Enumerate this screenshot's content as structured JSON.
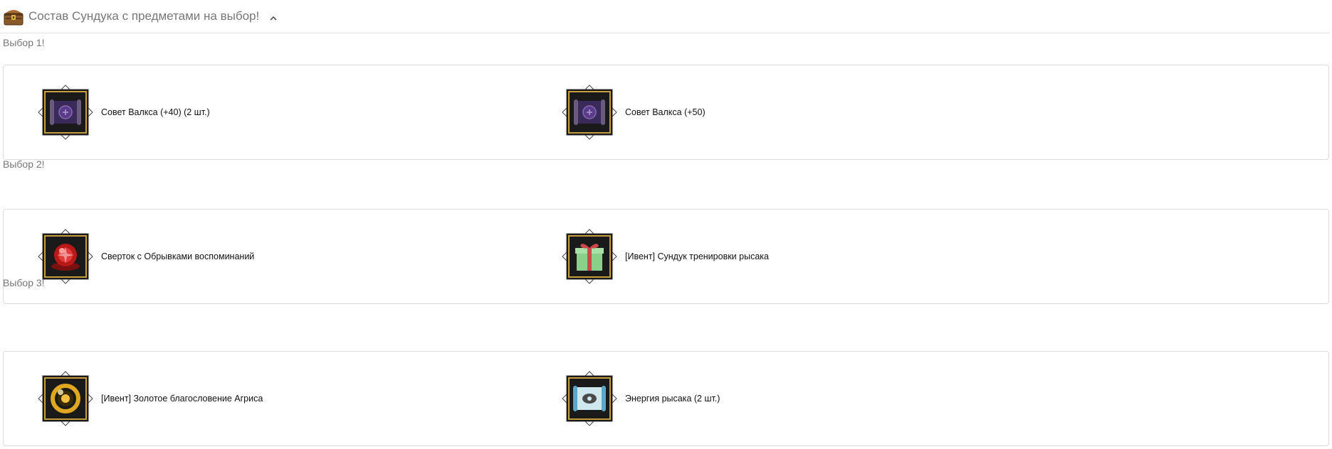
{
  "header": {
    "title": "Состав Сундука с предметами на выбор!",
    "chest_icon": "treasure-chest-icon",
    "collapse_icon": "chevron-up-icon"
  },
  "groups": [
    {
      "label": "Выбор 1!",
      "items": [
        {
          "name": "Совет Валкса (+40) (2 шт.)",
          "icon": "scroll-icon"
        },
        {
          "name": "Совет Валкса (+50)",
          "icon": "scroll-icon"
        }
      ]
    },
    {
      "label": "Выбор 2!",
      "items": [
        {
          "name": "Сверток с Обрывками воспоминаний",
          "icon": "red-orb-icon"
        },
        {
          "name": "[Ивент] Сундук тренировки рысака",
          "icon": "gift-box-icon"
        }
      ]
    },
    {
      "label": "Выбор 3!",
      "items": [
        {
          "name": "[Ивент] Золотое благословение Агриса",
          "icon": "gold-ring-icon"
        },
        {
          "name": "Энергия рысака (2 шт.)",
          "icon": "energy-scroll-icon"
        }
      ]
    }
  ],
  "colors": {
    "frame_gold": "#c8a040",
    "frame_border": "#3a3a3a",
    "box_border": "#dcdcdc",
    "label_text": "#777777"
  }
}
